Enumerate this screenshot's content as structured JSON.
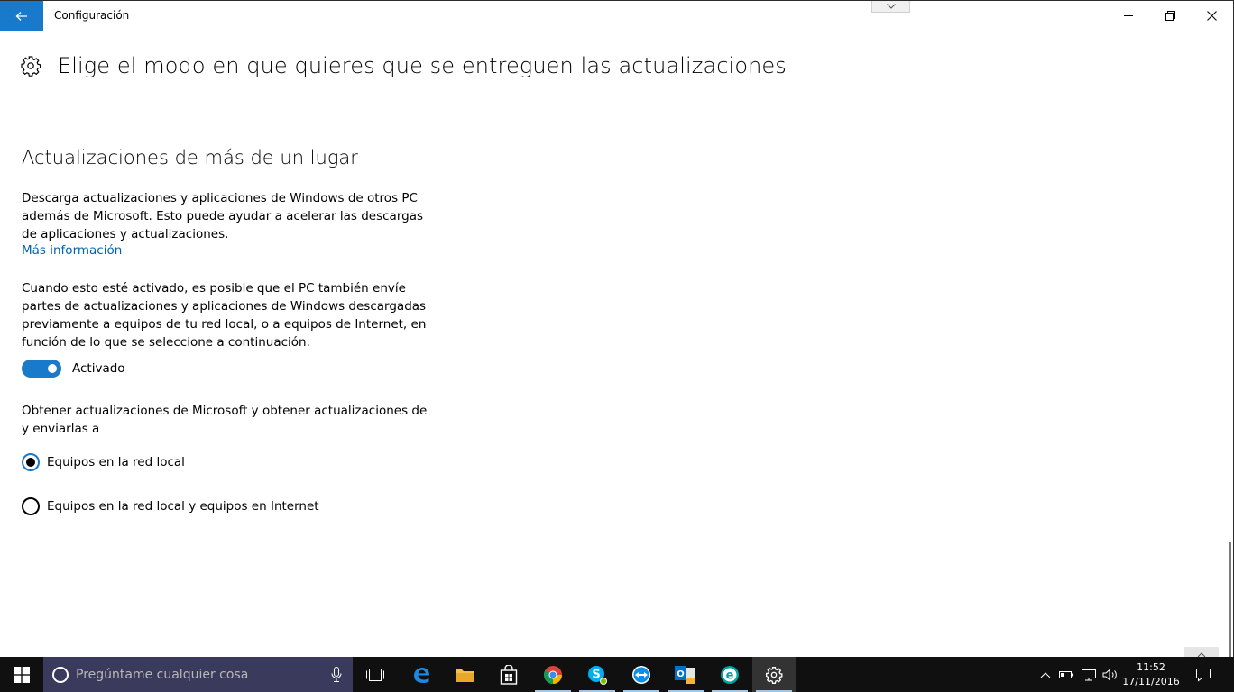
{
  "window": {
    "title": "Configuración",
    "back_label": "Atrás",
    "minimize": "Minimizar",
    "restore": "Restaurar",
    "close": "Cerrar"
  },
  "page": {
    "title": "Elige el modo en que quieres que se entreguen las actualizaciones",
    "section_title": "Actualizaciones de más de un lugar",
    "description1": "Descarga actualizaciones y aplicaciones de Windows de otros PC además de Microsoft. Esto puede ayudar a acelerar las descargas de aplicaciones y actualizaciones.",
    "more_info_link": "Más información",
    "description2": "Cuando esto esté activado, es posible que el PC también envíe partes de actualizaciones y aplicaciones de Windows descargadas previamente a equipos de tu red local, o a equipos de Internet, en función de lo que se seleccione a continuación.",
    "toggle": {
      "label": "Activado",
      "state": "on"
    },
    "radio_prompt": "Obtener actualizaciones de Microsoft y obtener actualizaciones de y enviarlas a",
    "radio_options": [
      {
        "label": "Equipos en la red local",
        "selected": true
      },
      {
        "label": "Equipos en la red local y equipos en Internet",
        "selected": false
      }
    ]
  },
  "taskbar": {
    "search_placeholder": "Pregúntame cualquier cosa",
    "pinned_icons": [
      "task-view-icon",
      "edge-icon",
      "file-explorer-icon",
      "store-icon",
      "chrome-icon",
      "skype-icon",
      "teamviewer-icon",
      "outlook-icon",
      "eset-icon",
      "settings-icon"
    ],
    "clock": {
      "time": "11:52",
      "date": "17/11/2016"
    }
  },
  "colors": {
    "accent": "#1979ca",
    "link": "#0063b1",
    "taskbar": "#101010",
    "search_box": "#3a3a5c"
  }
}
